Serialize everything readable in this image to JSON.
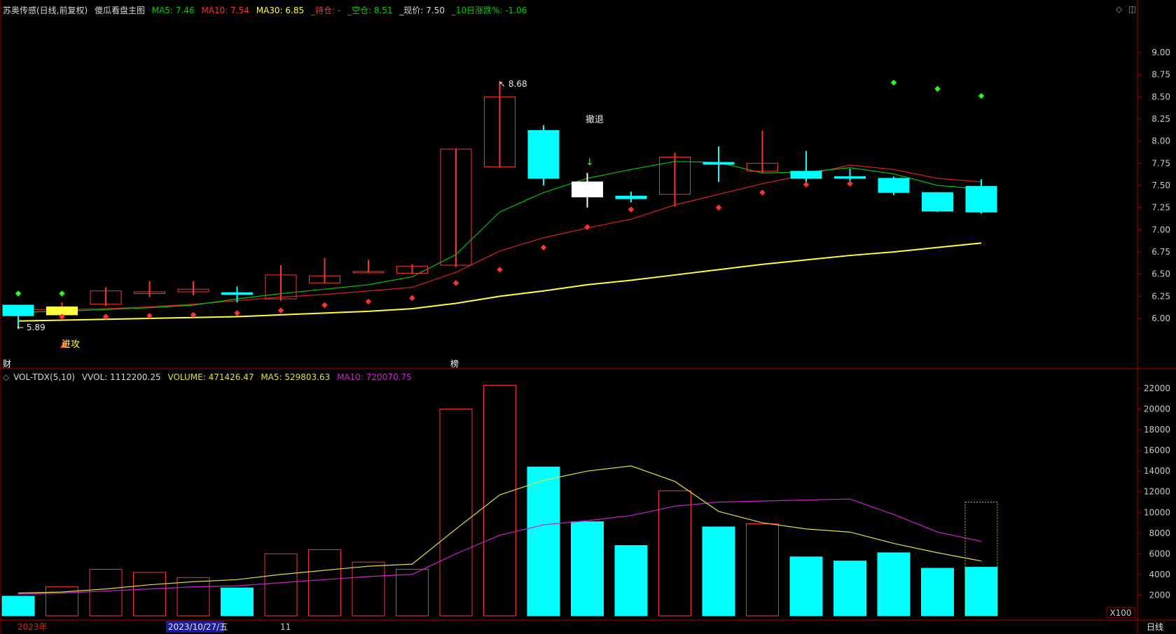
{
  "header": {
    "stock_name": "苏奥传感(日线,前复权)",
    "indicator_name": "傻瓜看盘主图",
    "ma5": "MA5: 7.46",
    "ma10": "MA10: 7.54",
    "ma30": "MA30: 6.85",
    "hold": "_持仓: -",
    "empty": "_空仓: 8.51",
    "price": "_现价: 7.50",
    "change10": "_10日涨跌%: -1.06"
  },
  "volume_header": {
    "name": "VOL-TDX(5,10)",
    "vvol": "VVOL: 1112200.25",
    "volume": "VOLUME: 471426.47",
    "ma5": "MA5: 529803.63",
    "ma10": "MA10: 720070.75"
  },
  "icons": {
    "diamond": "diamond-icon",
    "window": "window-toggle-icon"
  },
  "colors": {
    "up": "#ff3232",
    "down": "#00ffff",
    "ma5": "#00c800",
    "ma10": "#e02020",
    "ma30": "#ffff40",
    "vol_ma5": "#e0e040",
    "vol_ma10": "#d020d0",
    "axis": "#b00000",
    "header_green": "#00d000",
    "header_red": "#ff3030"
  },
  "chart_data": {
    "type": "candlestick",
    "price_axis": {
      "ylim": [
        5.6,
        9.3
      ],
      "ticks": [
        "9.00",
        "8.75",
        "8.50",
        "8.25",
        "8.00",
        "7.75",
        "7.50",
        "7.25",
        "7.00",
        "6.75",
        "6.50",
        "6.25",
        "6.00"
      ]
    },
    "volume_axis": {
      "ylim": [
        0,
        23000
      ],
      "ticks": [
        "22000",
        "20000",
        "18000",
        "16000",
        "14000",
        "12000",
        "10000",
        "8000",
        "6000",
        "4000",
        "2000"
      ],
      "unit": "X100"
    },
    "candles": [
      {
        "o": 6.15,
        "h": 6.1,
        "l": 5.89,
        "c": 6.03
      },
      {
        "o": 6.04,
        "h": 6.18,
        "l": 6.0,
        "c": 6.13
      },
      {
        "o": 6.16,
        "h": 6.35,
        "l": 6.14,
        "c": 6.31
      },
      {
        "o": 6.28,
        "h": 6.42,
        "l": 6.24,
        "c": 6.3
      },
      {
        "o": 6.3,
        "h": 6.42,
        "l": 6.26,
        "c": 6.33
      },
      {
        "o": 6.29,
        "h": 6.36,
        "l": 6.18,
        "c": 6.27
      },
      {
        "o": 6.22,
        "h": 6.6,
        "l": 6.2,
        "c": 6.49
      },
      {
        "o": 6.4,
        "h": 6.68,
        "l": 6.4,
        "c": 6.48
      },
      {
        "o": 6.52,
        "h": 6.66,
        "l": 6.52,
        "c": 6.53
      },
      {
        "o": 6.51,
        "h": 6.61,
        "l": 6.5,
        "c": 6.59
      },
      {
        "o": 6.6,
        "h": 7.91,
        "l": 6.58,
        "c": 7.91
      },
      {
        "o": 7.71,
        "h": 8.68,
        "l": 7.71,
        "c": 8.5
      },
      {
        "o": 8.12,
        "h": 8.18,
        "l": 7.5,
        "c": 7.58
      },
      {
        "o": 7.54,
        "h": 7.64,
        "l": 7.25,
        "c": 7.37
      },
      {
        "o": 7.38,
        "h": 7.43,
        "l": 7.31,
        "c": 7.35
      },
      {
        "o": 7.4,
        "h": 7.87,
        "l": 7.26,
        "c": 7.82
      },
      {
        "o": 7.76,
        "h": 7.94,
        "l": 7.54,
        "c": 7.74
      },
      {
        "o": 7.66,
        "h": 8.12,
        "l": 7.64,
        "c": 7.75
      },
      {
        "o": 7.66,
        "h": 7.89,
        "l": 7.53,
        "c": 7.58
      },
      {
        "o": 7.6,
        "h": 7.69,
        "l": 7.55,
        "c": 7.58
      },
      {
        "o": 7.58,
        "h": 7.6,
        "l": 7.39,
        "c": 7.42
      },
      {
        "o": 7.42,
        "h": 7.42,
        "l": 7.2,
        "c": 7.21
      },
      {
        "o": 7.49,
        "h": 7.57,
        "l": 7.18,
        "c": 7.2
      }
    ],
    "ma5": [
      6.07,
      6.08,
      6.1,
      6.12,
      6.15,
      6.22,
      6.28,
      6.33,
      6.38,
      6.47,
      6.72,
      7.2,
      7.42,
      7.58,
      7.68,
      7.77,
      7.76,
      7.64,
      7.65,
      7.7,
      7.63,
      7.5,
      7.46
    ],
    "ma10": [
      6.1,
      6.1,
      6.11,
      6.13,
      6.16,
      6.2,
      6.24,
      6.27,
      6.31,
      6.35,
      6.52,
      6.76,
      6.91,
      7.02,
      7.12,
      7.28,
      7.4,
      7.52,
      7.62,
      7.73,
      7.68,
      7.58,
      7.54
    ],
    "ma30": [
      5.97,
      5.98,
      5.99,
      6.0,
      6.01,
      6.02,
      6.04,
      6.06,
      6.08,
      6.11,
      6.17,
      6.25,
      6.31,
      6.38,
      6.43,
      6.49,
      6.55,
      6.61,
      6.66,
      6.71,
      6.75,
      6.8,
      6.85
    ],
    "green_dots": [
      {
        "i": 0,
        "v": 6.28
      },
      {
        "i": 1,
        "v": 6.28
      },
      {
        "i": 20,
        "v": 8.66
      },
      {
        "i": 21,
        "v": 8.59
      },
      {
        "i": 22,
        "v": 8.51
      }
    ],
    "red_dots": [
      {
        "i": 1,
        "v": 6.02
      },
      {
        "i": 2,
        "v": 6.02
      },
      {
        "i": 3,
        "v": 6.03
      },
      {
        "i": 4,
        "v": 6.04
      },
      {
        "i": 5,
        "v": 6.06
      },
      {
        "i": 6,
        "v": 6.09
      },
      {
        "i": 7,
        "v": 6.15
      },
      {
        "i": 8,
        "v": 6.19
      },
      {
        "i": 9,
        "v": 6.23
      },
      {
        "i": 10,
        "v": 6.4
      },
      {
        "i": 11,
        "v": 6.55
      },
      {
        "i": 12,
        "v": 6.8
      },
      {
        "i": 13,
        "v": 7.03
      },
      {
        "i": 14,
        "v": 7.23
      },
      {
        "i": 16,
        "v": 7.25
      },
      {
        "i": 17,
        "v": 7.42
      },
      {
        "i": 18,
        "v": 7.51
      },
      {
        "i": 19,
        "v": 7.52
      }
    ],
    "annotations": {
      "low_label": "5.89",
      "high_label": "8.68",
      "attack_label": "进攻",
      "retreat_label": "撤退",
      "fin_label": "财",
      "list_label": "榜"
    },
    "volume": [
      1900,
      2800,
      4500,
      4200,
      3700,
      2700,
      6000,
      6400,
      5200,
      4500,
      20000,
      22300,
      14400,
      9100,
      6800,
      12100,
      8600,
      8900,
      5700,
      5300,
      6100,
      4600,
      4700
    ],
    "volume_ghost": 11000,
    "vol_ma5": [
      2200,
      2300,
      2600,
      3000,
      3300,
      3500,
      4000,
      4400,
      4800,
      5000,
      8400,
      11700,
      13100,
      14000,
      14500,
      13000,
      10100,
      9000,
      8400,
      8100,
      7000,
      6100,
      5300
    ],
    "vol_ma10": [
      2100,
      2200,
      2400,
      2600,
      2800,
      2900,
      3200,
      3500,
      3800,
      4000,
      6000,
      7800,
      8800,
      9200,
      9700,
      10600,
      11000,
      11100,
      11200,
      11300,
      9800,
      8100,
      7200
    ],
    "x_labels": [
      "2023年",
      "2023/10/27/五",
      "11"
    ],
    "period_label": "日线"
  }
}
